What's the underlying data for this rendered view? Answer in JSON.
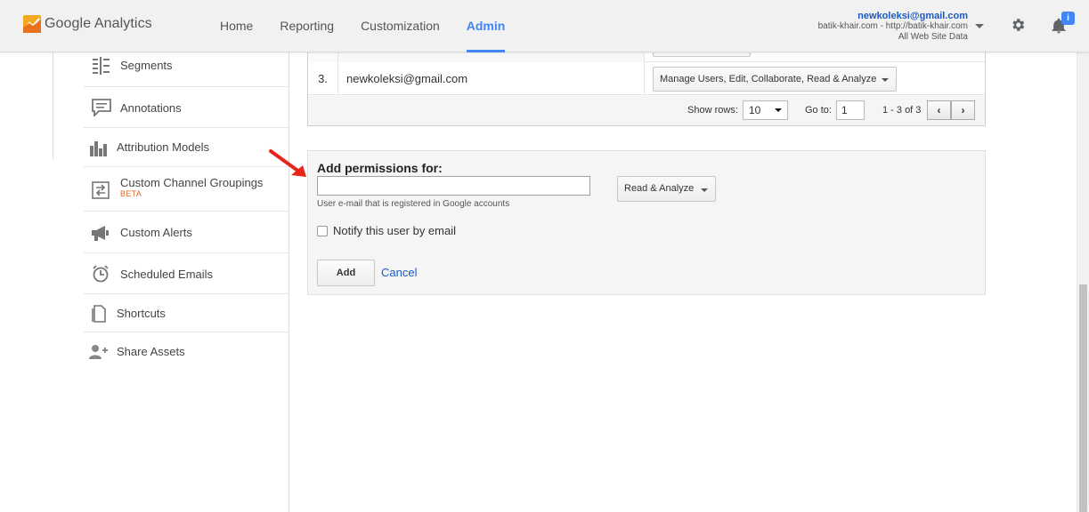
{
  "header": {
    "brand": "Google Analytics",
    "nav": [
      {
        "label": "Home"
      },
      {
        "label": "Reporting"
      },
      {
        "label": "Customization"
      },
      {
        "label": "Admin",
        "active": true
      }
    ],
    "account": {
      "email": "newkoleksi@gmail.com",
      "property": "batik-khair.com - http://batik-khair.com",
      "view": "All Web Site Data"
    },
    "notification_badge": "i",
    "icons": {
      "settings": "gear-icon",
      "notifications": "bell-icon"
    }
  },
  "sidebar": {
    "items": [
      {
        "label": "Segments",
        "icon": "segments-icon"
      },
      {
        "label": "Annotations",
        "icon": "annotations-icon"
      },
      {
        "label": "Attribution Models",
        "icon": "attribution-icon"
      },
      {
        "label": "Custom Channel Groupings",
        "sub": "BETA",
        "icon": "channel-groupings-icon"
      },
      {
        "label": "Custom Alerts",
        "icon": "megaphone-icon"
      },
      {
        "label": "Scheduled Emails",
        "icon": "clock-icon"
      },
      {
        "label": "Shortcuts",
        "icon": "document-icon"
      },
      {
        "label": "Share Assets",
        "icon": "add-person-icon"
      }
    ]
  },
  "users_table": {
    "rows": [
      {
        "index": "3.",
        "email": "newkoleksi@gmail.com",
        "permissions": "Manage Users, Edit, Collaborate, Read & Analyze"
      }
    ],
    "pager": {
      "show_rows_label": "Show rows:",
      "rows_value": "10",
      "goto_label": "Go to:",
      "goto_value": "1",
      "range": "1 - 3 of 3",
      "prev": "‹",
      "next": "›"
    }
  },
  "add_permissions": {
    "title": "Add permissions for:",
    "email_value": "",
    "hint": "User e-mail that is registered in Google accounts",
    "role": "Read & Analyze",
    "notify_label": "Notify this user by email",
    "notify_checked": false,
    "add_label": "Add",
    "cancel_label": "Cancel"
  },
  "colors": {
    "accent": "#4285f4",
    "link": "#1a5ac6",
    "annotation_arrow": "#e8231a",
    "beta": "#dd6b2a"
  }
}
